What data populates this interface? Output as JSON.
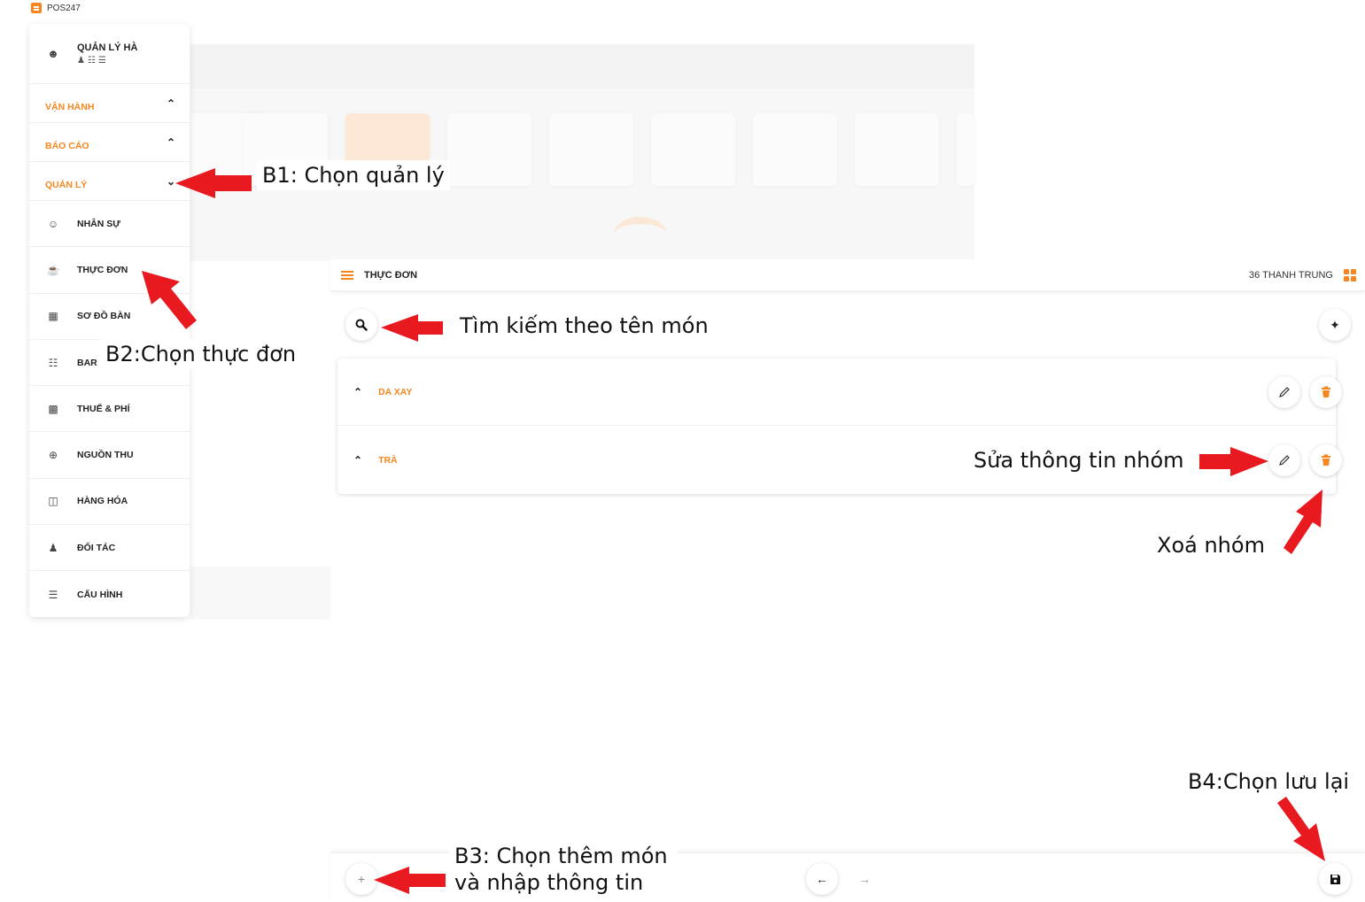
{
  "app": {
    "name": "POS247"
  },
  "sidebar": {
    "user": {
      "name": "QUẢN LÝ HÀ",
      "roles": "♟☷☰"
    },
    "sections": [
      {
        "label": "VẬN HÀNH",
        "chevron": "^"
      },
      {
        "label": "BÁO CÁO",
        "chevron": "^"
      },
      {
        "label": "QUẢN LÝ",
        "chevron": "v"
      }
    ],
    "items": [
      {
        "label": "NHÂN SỰ",
        "icon": "people-icon"
      },
      {
        "label": "THỰC ĐƠN",
        "icon": "cup-icon"
      },
      {
        "label": "SƠ ĐỒ BÀN",
        "icon": "table-grid-icon"
      },
      {
        "label": "BAR",
        "icon": "bar-icon"
      },
      {
        "label": "THUẾ & PHÍ",
        "icon": "invoice-icon"
      },
      {
        "label": "NGUỒN THU",
        "icon": "plus-circle-icon"
      },
      {
        "label": "HÀNG HÓA",
        "icon": "boxes-icon"
      },
      {
        "label": "ĐỐI TÁC",
        "icon": "partner-icon"
      },
      {
        "label": "CẤU HÌNH",
        "icon": "sliders-icon"
      }
    ]
  },
  "main": {
    "title": "THỰC ĐƠN",
    "store": "36 THANH TRUNG",
    "groups": [
      {
        "name": "DA XAY"
      },
      {
        "name": "TRÀ"
      }
    ]
  },
  "annotations": {
    "b1": "B1: Chọn quản lý",
    "b2": "B2:Chọn thực đơn",
    "search": "Tìm kiếm theo tên món",
    "edit": "Sửa thông tin nhóm",
    "delete": "Xoá nhóm",
    "b3_line1": "B3: Chọn thêm món",
    "b3_line2": "và nhập thông tin",
    "b4": "B4:Chọn lưu lại"
  },
  "colors": {
    "accent": "#f7861e",
    "arrow": "#e8191f"
  }
}
